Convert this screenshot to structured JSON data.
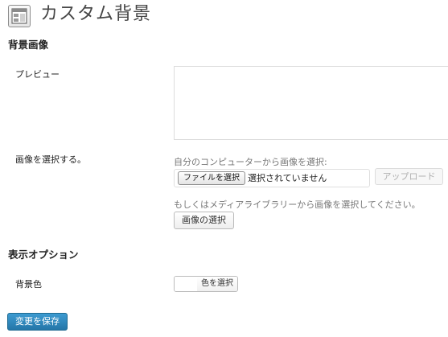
{
  "header": {
    "icon": "page-layout-icon",
    "title": "カスタム背景"
  },
  "background_image": {
    "heading": "背景画像",
    "preview_label": "プレビュー",
    "select_label": "画像を選択する。",
    "upload_hint": "自分のコンピューターから画像を選択:",
    "file_button": "ファイルを選択",
    "file_status": "選択されていません",
    "upload_button": "アップロード",
    "library_hint": "もしくはメディアライブラリーから画像を選択してください。",
    "library_button": "画像の選択"
  },
  "display_options": {
    "heading": "表示オプション",
    "bg_color_label": "背景色",
    "color_button": "色を選択",
    "swatch_color": "#ffffff"
  },
  "footer": {
    "save_button": "変更を保存"
  }
}
